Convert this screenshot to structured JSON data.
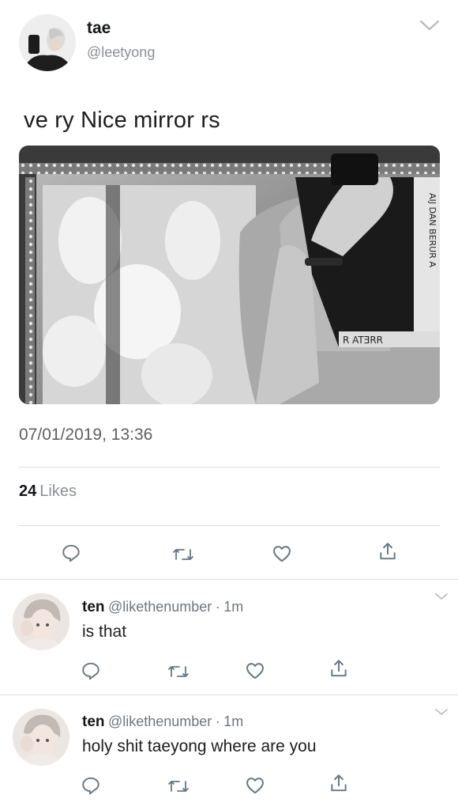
{
  "tweet": {
    "name": "tae",
    "handle": "@leetyong",
    "text": "ve ry Nice mirror rs",
    "timestamp": "07/01/2019, 13:36",
    "likes_count": "24",
    "likes_label": "Likes"
  },
  "replies": [
    {
      "name": "ten",
      "handle": "@likethenumber",
      "separator": "·",
      "time": "1m",
      "text": "is that"
    },
    {
      "name": "ten",
      "handle": "@likethenumber",
      "separator": "·",
      "time": "1m",
      "text": "holy shit taeyong where are you"
    }
  ],
  "icons": {
    "reply": "reply-icon",
    "retweet": "retweet-icon",
    "like": "heart-icon",
    "share": "share-icon",
    "menu": "chevron-down-icon"
  },
  "colors": {
    "text": "#14171a",
    "secondary": "#8a8f96",
    "divider": "#d9dde1",
    "icon": "#657786"
  }
}
